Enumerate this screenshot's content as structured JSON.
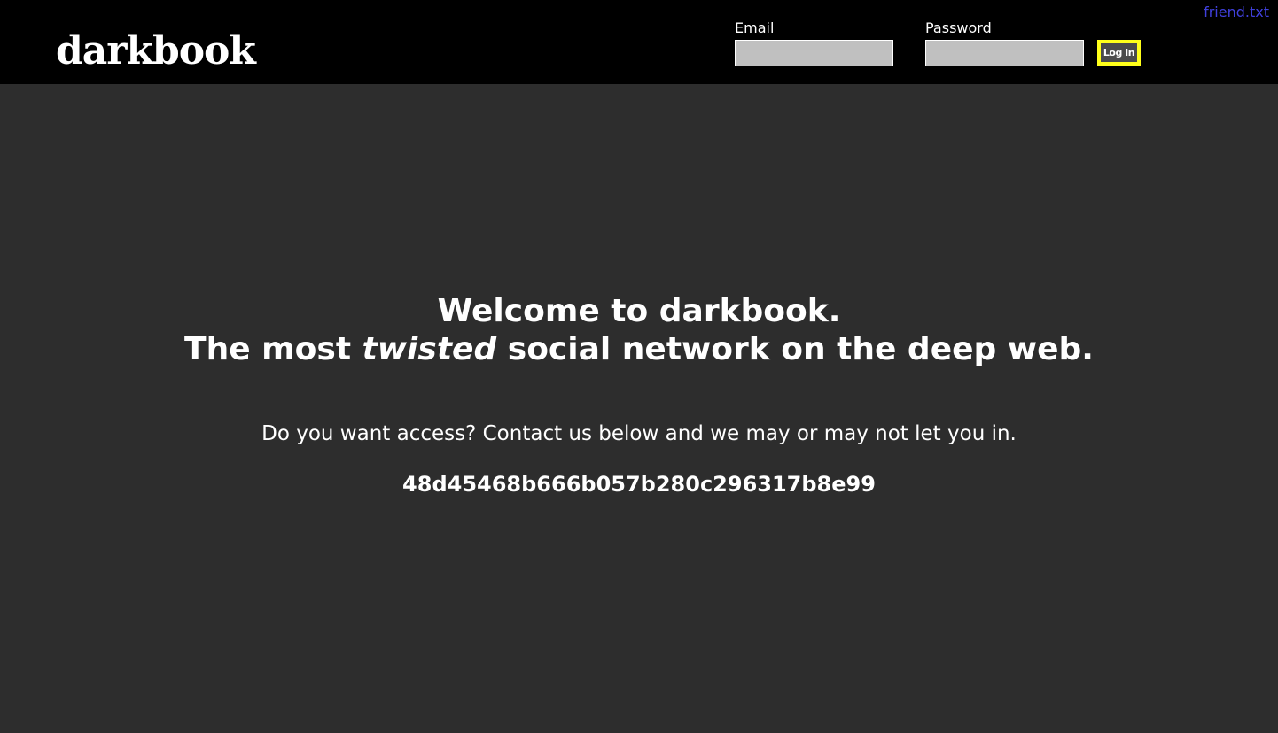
{
  "header": {
    "logo": "darkbook",
    "email_label": "Email",
    "email_value": "",
    "password_label": "Password",
    "password_value": "",
    "login_label": "Log In",
    "friend_link": "friend.txt"
  },
  "main": {
    "headline_line1": "Welcome to darkbook.",
    "headline_line2_before": "The most ",
    "headline_line2_emphasis": "twisted",
    "headline_line2_after": " social network on the deep web.",
    "subtext": "Do you want access? Contact us below and we may or may not let you in.",
    "contact_hash": "48d45468b666b057b280c296317b8e99"
  },
  "colors": {
    "page_background": "#2d2d2d",
    "topbar_background": "#000000",
    "input_background": "#c0c0c0",
    "login_border": "#ffff1a",
    "link": "#4040dd"
  }
}
